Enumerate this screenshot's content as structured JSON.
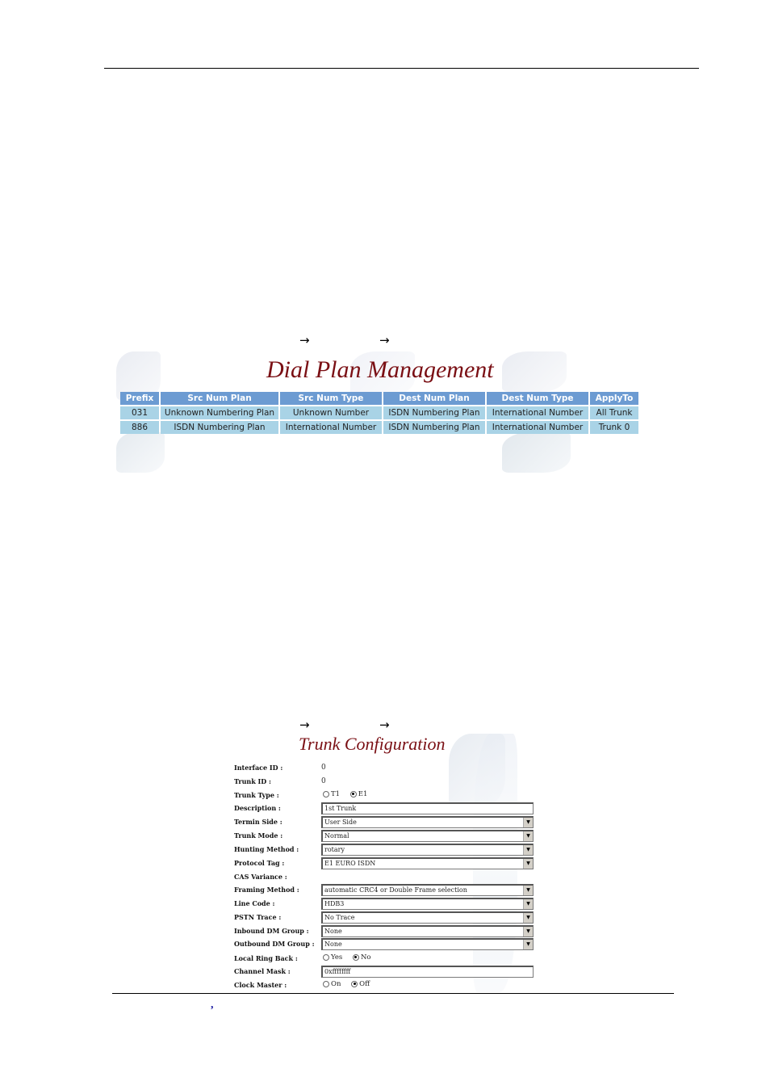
{
  "document": {
    "nav_arrow": "→",
    "footer_mark": ","
  },
  "dial_plan": {
    "title": "Dial Plan Management",
    "columns": [
      "Prefix",
      "Src Num Plan",
      "Src Num Type",
      "Dest Num Plan",
      "Dest Num Type",
      "ApplyTo"
    ],
    "rows": [
      [
        "031",
        "Unknown Numbering Plan",
        "Unknown Number",
        "ISDN Numbering Plan",
        "International Number",
        "All Trunk"
      ],
      [
        "886",
        "ISDN Numbering Plan",
        "International Number",
        "ISDN Numbering Plan",
        "International Number",
        "Trunk 0"
      ]
    ],
    "colors": {
      "header_bg": "#6c9bd2",
      "cell_bg": "#a9d3e6",
      "title": "#7a0f14"
    }
  },
  "trunk_config": {
    "title": "Trunk Configuration",
    "fields": {
      "interface_id": {
        "label": "Interface ID :",
        "value": "0"
      },
      "trunk_id": {
        "label": "Trunk ID :",
        "value": "0"
      },
      "trunk_type": {
        "label": "Trunk Type :",
        "options": [
          "T1",
          "E1"
        ],
        "selected": "E1"
      },
      "description": {
        "label": "Description :",
        "value": "1st Trunk"
      },
      "termin_side": {
        "label": "Termin Side :",
        "value": "User Side"
      },
      "trunk_mode": {
        "label": "Trunk Mode :",
        "value": "Normal"
      },
      "hunting_method": {
        "label": "Hunting Method :",
        "value": "rotary"
      },
      "protocol_tag": {
        "label": "Protocol Tag :",
        "value": "E1 EURO ISDN"
      },
      "cas_variance": {
        "label": "CAS Variance :"
      },
      "framing_method": {
        "label": "Framing Method :",
        "value": "automatic CRC4 or Double Frame selection"
      },
      "line_code": {
        "label": "Line Code :",
        "value": "HDB3"
      },
      "pstn_trace": {
        "label": "PSTN Trace :",
        "value": "No Trace"
      },
      "inbound_dm_group": {
        "label": "Inbound DM Group :",
        "value": "None"
      },
      "outbound_dm_group": {
        "label": "Outbound DM Group :",
        "value": "None"
      },
      "local_ring_back": {
        "label": "Local Ring Back :",
        "options": [
          "Yes",
          "No"
        ],
        "selected": "No"
      },
      "channel_mask": {
        "label": "Channel Mask :",
        "value": "0xffffffff"
      },
      "clock_master": {
        "label": "Clock Master :",
        "options": [
          "On",
          "Off"
        ],
        "selected": "Off"
      }
    }
  }
}
